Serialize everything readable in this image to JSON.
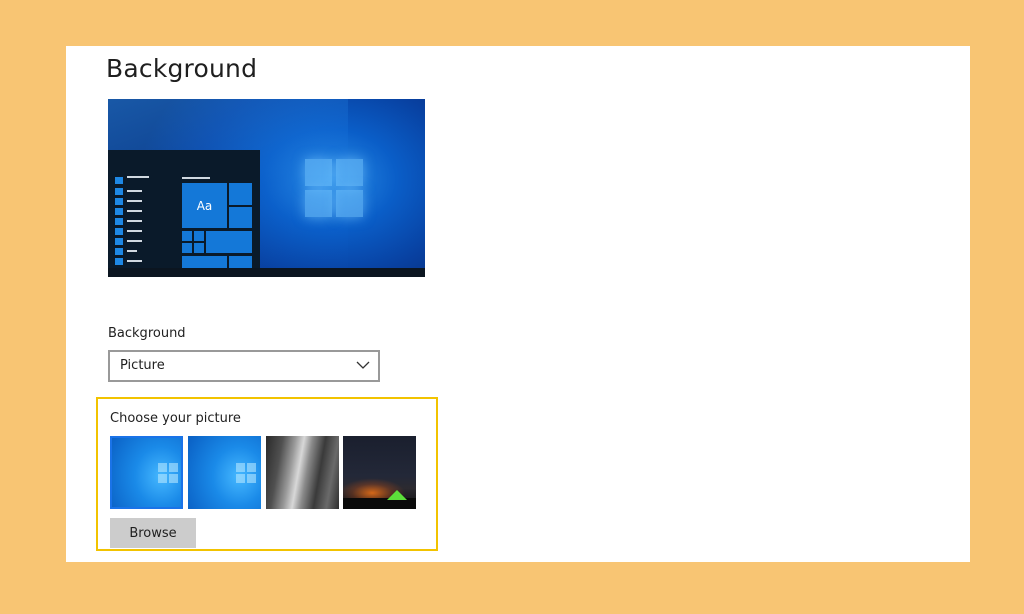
{
  "page": {
    "title": "Background"
  },
  "preview": {
    "tile_text": "Aa"
  },
  "background_field": {
    "label": "Background",
    "selected_value": "Picture"
  },
  "choose_picture": {
    "label": "Choose your picture",
    "thumbnails": [
      {
        "name": "windows-blue-light",
        "selected": true
      },
      {
        "name": "windows-blue",
        "selected": false
      },
      {
        "name": "rock-waterfall",
        "selected": false
      },
      {
        "name": "night-sky-tent",
        "selected": false
      }
    ],
    "browse_label": "Browse"
  },
  "colors": {
    "outer_background": "#F8C573",
    "highlight_border": "#F2C300",
    "accent_blue": "#1A73E8",
    "button_gray": "#CCCCCC"
  },
  "icons": {
    "dropdown": "chevron-down-icon",
    "preview_logo": "windows-logo-icon"
  }
}
